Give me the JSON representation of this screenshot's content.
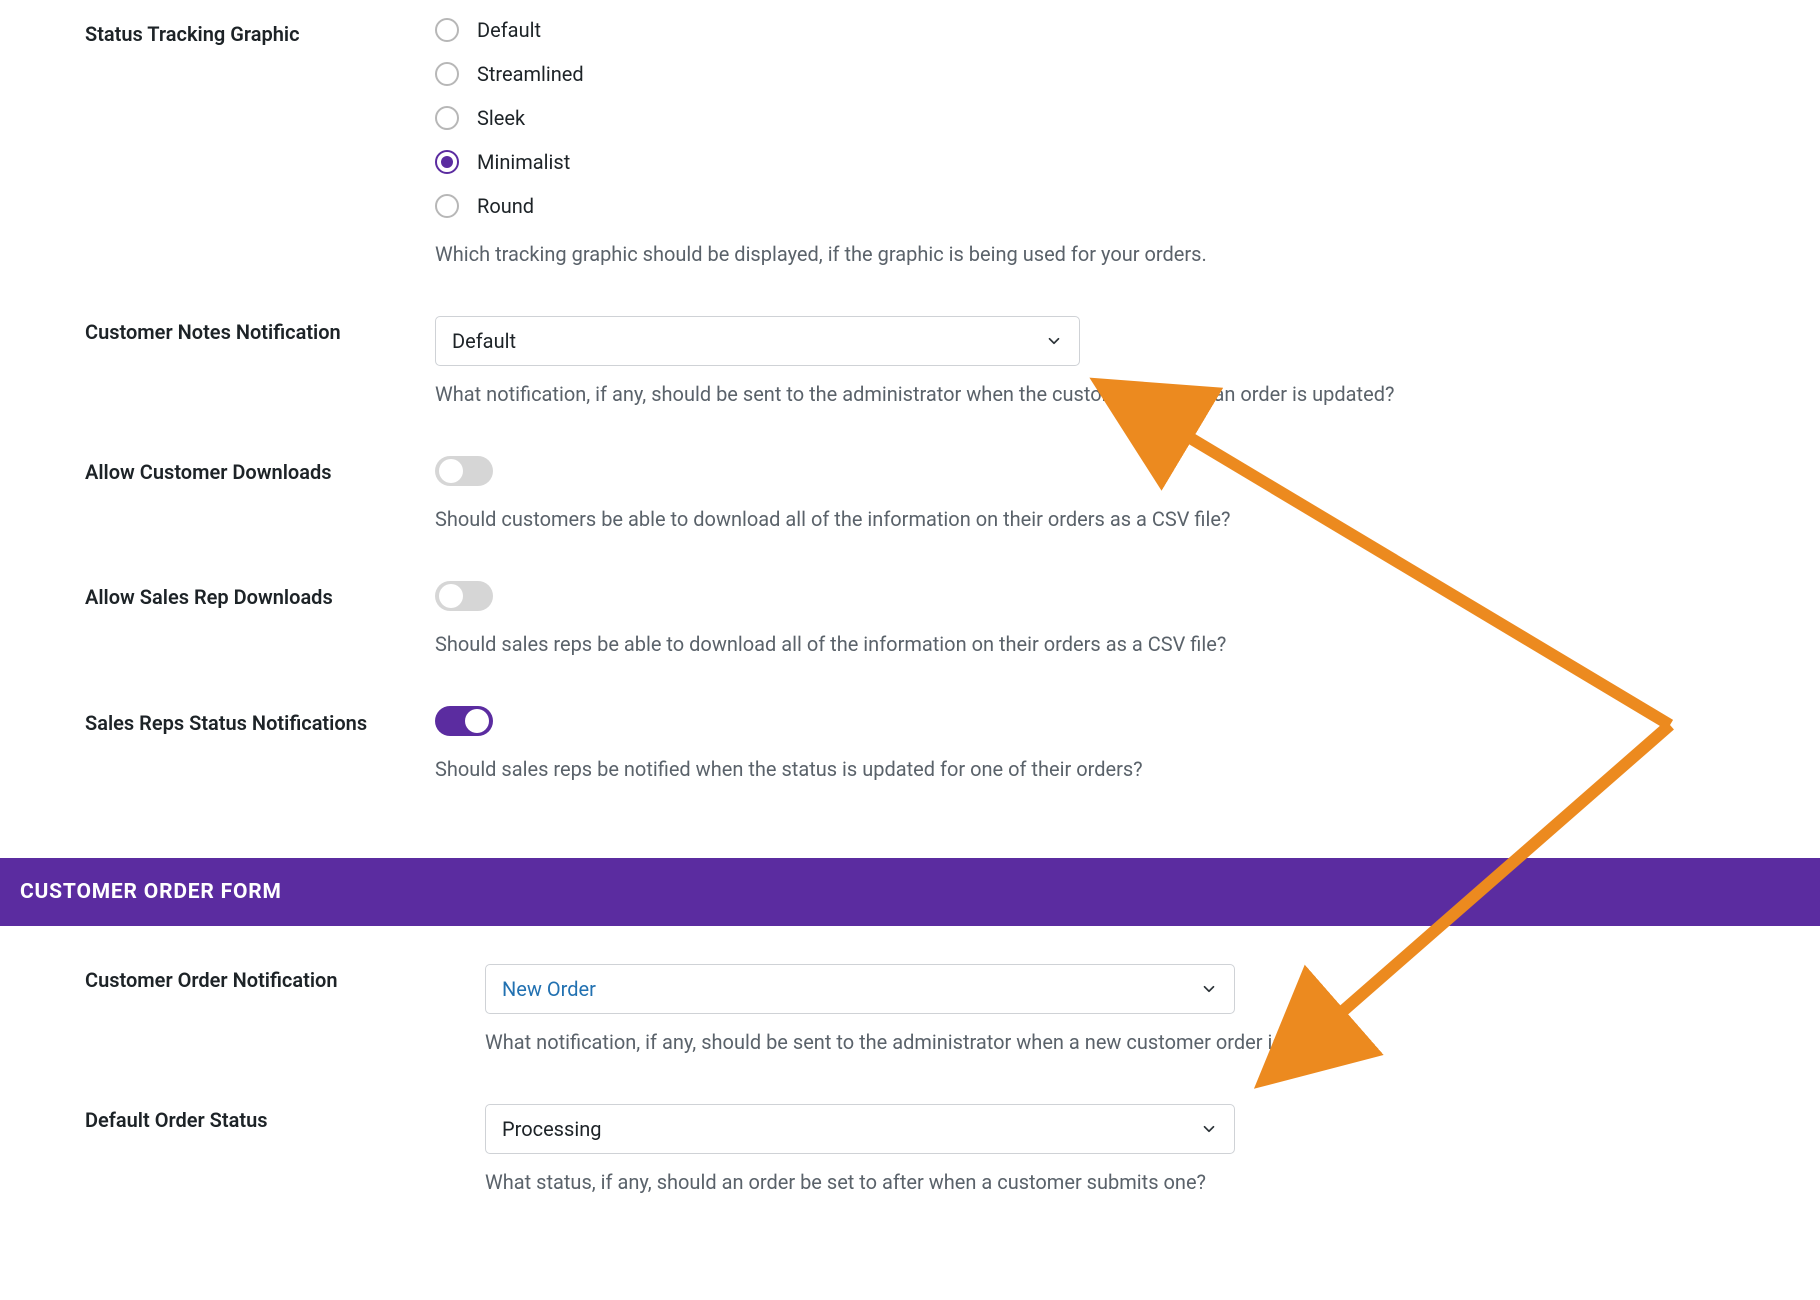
{
  "tracking_graphic": {
    "label": "Status Tracking Graphic",
    "options": {
      "default": "Default",
      "streamlined": "Streamlined",
      "sleek": "Sleek",
      "minimalist": "Minimalist",
      "round": "Round"
    },
    "description": "Which tracking graphic should be displayed, if the graphic is being used for your orders."
  },
  "customer_notes": {
    "label": "Customer Notes Notification",
    "value": "Default",
    "description": "What notification, if any, should be sent to the administrator when the customer note on an order is updated?"
  },
  "customer_downloads": {
    "label": "Allow Customer Downloads",
    "description": "Should customers be able to download all of the information on their orders as a CSV file?"
  },
  "rep_downloads": {
    "label": "Allow Sales Rep Downloads",
    "description": "Should sales reps be able to download all of the information on their orders as a CSV file?"
  },
  "rep_notifications": {
    "label": "Sales Reps Status Notifications",
    "description": "Should sales reps be notified when the status is updated for one of their orders?"
  },
  "section_customer_form": "CUSTOMER ORDER FORM",
  "customer_order_notification": {
    "label": "Customer Order Notification",
    "value": "New Order",
    "description": "What notification, if any, should be sent to the administrator when a new customer order is created?"
  },
  "default_order_status": {
    "label": "Default Order Status",
    "value": "Processing",
    "description": "What status, if any, should an order be set to after when a customer submits one?"
  }
}
